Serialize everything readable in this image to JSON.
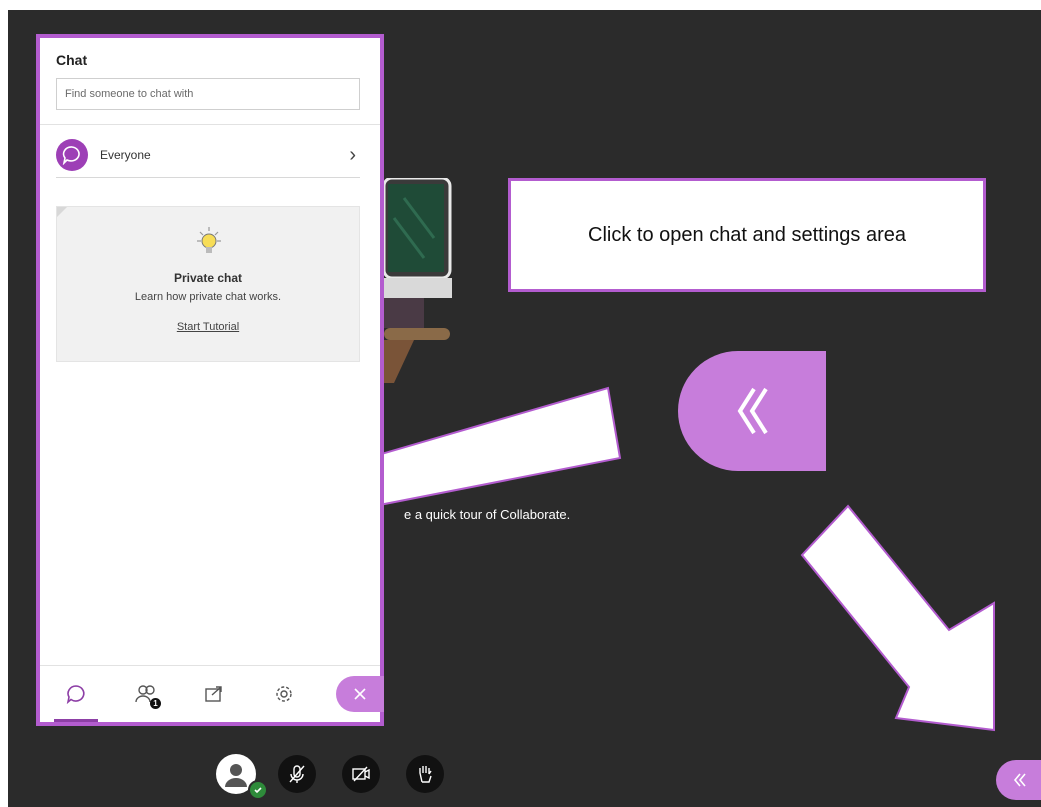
{
  "chat": {
    "title": "Chat",
    "search_placeholder": "Find someone to chat with",
    "everyone_label": "Everyone",
    "tip": {
      "title": "Private chat",
      "text": "Learn how private chat works.",
      "link": "Start Tutorial"
    },
    "tabs": [
      {
        "name": "chat-bubble-icon",
        "active": true
      },
      {
        "name": "attendees-icon",
        "badge": "1"
      },
      {
        "name": "share-content-icon"
      },
      {
        "name": "gear-icon"
      }
    ],
    "close_icon": "close-icon"
  },
  "scene": {
    "caption": "e a quick tour of Collaborate."
  },
  "callout": {
    "text": "Click to open chat and settings area"
  },
  "controls": [
    {
      "name": "avatar-icon"
    },
    {
      "name": "microphone-muted-icon"
    },
    {
      "name": "camera-off-icon"
    },
    {
      "name": "raise-hand-icon"
    }
  ],
  "colors": {
    "accent": "#b35ccf",
    "accent_light": "#c77ddb",
    "purple_dark": "#9d3fb6",
    "background": "#2b2b2b",
    "status_green": "#2e8b3a"
  }
}
